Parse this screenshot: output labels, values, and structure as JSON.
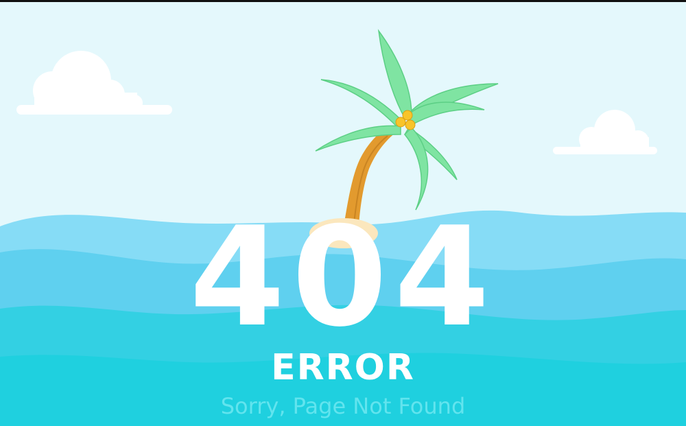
{
  "page": {
    "code": "404",
    "title": "ERROR",
    "subtitle": "Sorry, Page Not Found"
  },
  "illustration": {
    "icons": [
      "cloud-icon",
      "palm-tree-icon",
      "coconut-icon",
      "sand-island-icon",
      "ocean-wave-icon"
    ]
  },
  "colors": {
    "sky": "#e4f8fc",
    "sea_light": "#86dcf6",
    "sea_mid": "#5fd0ef",
    "sea_deep": "#33d0e3",
    "sand": "#fbe7bd",
    "trunk": "#e29a2e",
    "leaf": "#7fe4a2",
    "coconut": "#f8c42a",
    "subtitle": "#62e4ee",
    "text": "#ffffff"
  }
}
